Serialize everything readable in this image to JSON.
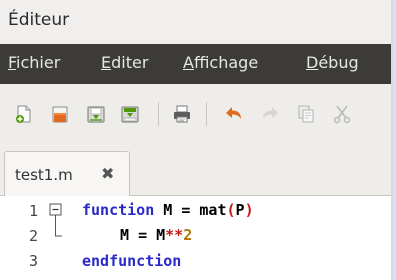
{
  "window": {
    "title": "Éditeur"
  },
  "menu": [
    {
      "label": "Fichier",
      "mnemonic": "F"
    },
    {
      "label": "Editer",
      "mnemonic": "E"
    },
    {
      "label": "Affichage",
      "mnemonic": "A"
    },
    {
      "label": "Débug",
      "mnemonic": "D"
    }
  ],
  "toolbar": {
    "icons": [
      "new-file-icon",
      "open-folder-icon",
      "save-icon",
      "save-as-icon",
      "print-icon",
      "undo-icon",
      "redo-icon",
      "copy-icon",
      "cut-icon"
    ]
  },
  "tab": {
    "label": "test1.m",
    "close": "✖"
  },
  "editor": {
    "lines": [
      {
        "num": "1",
        "fold": "minus"
      },
      {
        "num": "2",
        "fold": "end"
      },
      {
        "num": "3",
        "fold": ""
      }
    ],
    "code": {
      "l1_kw": "function",
      "l1_rest_a": " M ",
      "l1_eq": "=",
      "l1_rest_b": " mat",
      "l1_paren_open": "(",
      "l1_arg": "P",
      "l1_paren_close": ")",
      "l2_a": "M ",
      "l2_eq": "=",
      "l2_b": " M",
      "l2_pow": "**",
      "l2_num": "2",
      "l3_kw": "endfunction"
    }
  },
  "colors": {
    "menubar": "#3c3b37",
    "keyword": "#2a28c8",
    "power_op": "#c81414",
    "number": "#b07800"
  }
}
